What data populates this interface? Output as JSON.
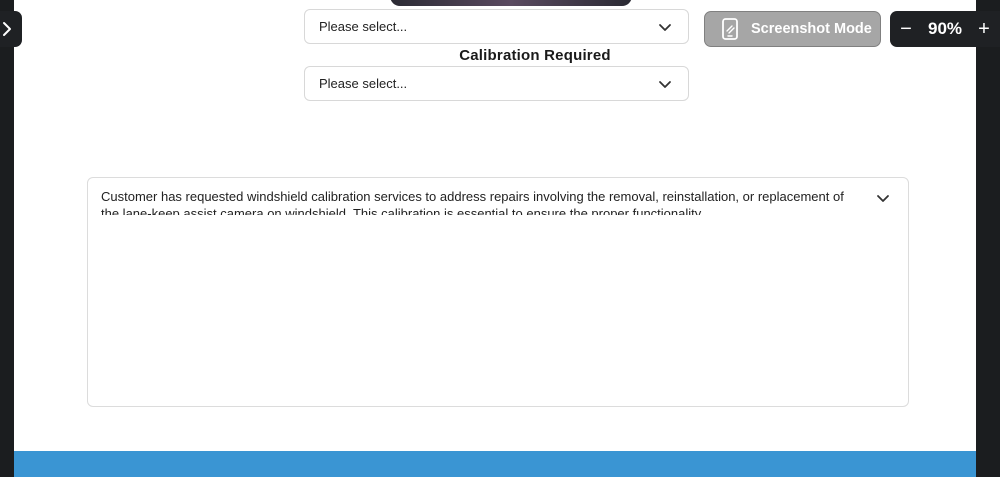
{
  "selects": [
    {
      "value": "Please select..."
    },
    {
      "value": "Please select..."
    }
  ],
  "calibration": {
    "label": "Calibration Required"
  },
  "description": {
    "text": "Customer has requested windshield calibration services to address repairs involving the removal, reinstallation, or replacement of the lane-keep assist camera on windshield. This calibration is essential to ensure the proper functionality"
  },
  "toolbar": {
    "screenshot_label": "Screenshot Mode",
    "zoom_level": "90%",
    "zoom_minus": "−",
    "zoom_plus": "+"
  },
  "icons": {
    "chevron": "chevron-down-icon",
    "phone": "phone-icon",
    "side_toggle": "chevron-right-icon"
  },
  "colors": {
    "footer_bar": "#3a95d3",
    "screenshot_button": "#a6a6a6",
    "toolbar_dark": "#1f2124"
  }
}
